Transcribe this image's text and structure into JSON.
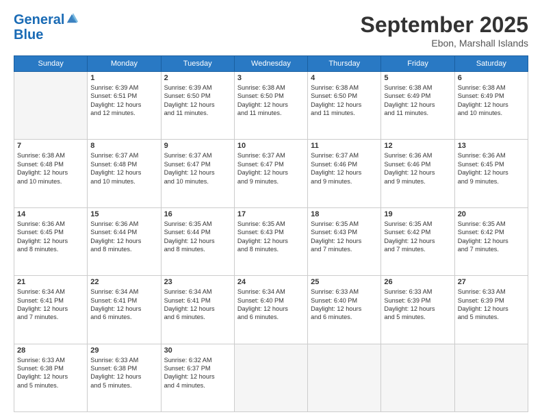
{
  "logo": {
    "line1": "General",
    "line2": "Blue"
  },
  "title": "September 2025",
  "subtitle": "Ebon, Marshall Islands",
  "days_of_week": [
    "Sunday",
    "Monday",
    "Tuesday",
    "Wednesday",
    "Thursday",
    "Friday",
    "Saturday"
  ],
  "weeks": [
    [
      {
        "day": "",
        "text": ""
      },
      {
        "day": "1",
        "text": "Sunrise: 6:39 AM\nSunset: 6:51 PM\nDaylight: 12 hours\nand 12 minutes."
      },
      {
        "day": "2",
        "text": "Sunrise: 6:39 AM\nSunset: 6:50 PM\nDaylight: 12 hours\nand 11 minutes."
      },
      {
        "day": "3",
        "text": "Sunrise: 6:38 AM\nSunset: 6:50 PM\nDaylight: 12 hours\nand 11 minutes."
      },
      {
        "day": "4",
        "text": "Sunrise: 6:38 AM\nSunset: 6:50 PM\nDaylight: 12 hours\nand 11 minutes."
      },
      {
        "day": "5",
        "text": "Sunrise: 6:38 AM\nSunset: 6:49 PM\nDaylight: 12 hours\nand 11 minutes."
      },
      {
        "day": "6",
        "text": "Sunrise: 6:38 AM\nSunset: 6:49 PM\nDaylight: 12 hours\nand 10 minutes."
      }
    ],
    [
      {
        "day": "7",
        "text": "Sunrise: 6:38 AM\nSunset: 6:48 PM\nDaylight: 12 hours\nand 10 minutes."
      },
      {
        "day": "8",
        "text": "Sunrise: 6:37 AM\nSunset: 6:48 PM\nDaylight: 12 hours\nand 10 minutes."
      },
      {
        "day": "9",
        "text": "Sunrise: 6:37 AM\nSunset: 6:47 PM\nDaylight: 12 hours\nand 10 minutes."
      },
      {
        "day": "10",
        "text": "Sunrise: 6:37 AM\nSunset: 6:47 PM\nDaylight: 12 hours\nand 9 minutes."
      },
      {
        "day": "11",
        "text": "Sunrise: 6:37 AM\nSunset: 6:46 PM\nDaylight: 12 hours\nand 9 minutes."
      },
      {
        "day": "12",
        "text": "Sunrise: 6:36 AM\nSunset: 6:46 PM\nDaylight: 12 hours\nand 9 minutes."
      },
      {
        "day": "13",
        "text": "Sunrise: 6:36 AM\nSunset: 6:45 PM\nDaylight: 12 hours\nand 9 minutes."
      }
    ],
    [
      {
        "day": "14",
        "text": "Sunrise: 6:36 AM\nSunset: 6:45 PM\nDaylight: 12 hours\nand 8 minutes."
      },
      {
        "day": "15",
        "text": "Sunrise: 6:36 AM\nSunset: 6:44 PM\nDaylight: 12 hours\nand 8 minutes."
      },
      {
        "day": "16",
        "text": "Sunrise: 6:35 AM\nSunset: 6:44 PM\nDaylight: 12 hours\nand 8 minutes."
      },
      {
        "day": "17",
        "text": "Sunrise: 6:35 AM\nSunset: 6:43 PM\nDaylight: 12 hours\nand 8 minutes."
      },
      {
        "day": "18",
        "text": "Sunrise: 6:35 AM\nSunset: 6:43 PM\nDaylight: 12 hours\nand 7 minutes."
      },
      {
        "day": "19",
        "text": "Sunrise: 6:35 AM\nSunset: 6:42 PM\nDaylight: 12 hours\nand 7 minutes."
      },
      {
        "day": "20",
        "text": "Sunrise: 6:35 AM\nSunset: 6:42 PM\nDaylight: 12 hours\nand 7 minutes."
      }
    ],
    [
      {
        "day": "21",
        "text": "Sunrise: 6:34 AM\nSunset: 6:41 PM\nDaylight: 12 hours\nand 7 minutes."
      },
      {
        "day": "22",
        "text": "Sunrise: 6:34 AM\nSunset: 6:41 PM\nDaylight: 12 hours\nand 6 minutes."
      },
      {
        "day": "23",
        "text": "Sunrise: 6:34 AM\nSunset: 6:41 PM\nDaylight: 12 hours\nand 6 minutes."
      },
      {
        "day": "24",
        "text": "Sunrise: 6:34 AM\nSunset: 6:40 PM\nDaylight: 12 hours\nand 6 minutes."
      },
      {
        "day": "25",
        "text": "Sunrise: 6:33 AM\nSunset: 6:40 PM\nDaylight: 12 hours\nand 6 minutes."
      },
      {
        "day": "26",
        "text": "Sunrise: 6:33 AM\nSunset: 6:39 PM\nDaylight: 12 hours\nand 5 minutes."
      },
      {
        "day": "27",
        "text": "Sunrise: 6:33 AM\nSunset: 6:39 PM\nDaylight: 12 hours\nand 5 minutes."
      }
    ],
    [
      {
        "day": "28",
        "text": "Sunrise: 6:33 AM\nSunset: 6:38 PM\nDaylight: 12 hours\nand 5 minutes."
      },
      {
        "day": "29",
        "text": "Sunrise: 6:33 AM\nSunset: 6:38 PM\nDaylight: 12 hours\nand 5 minutes."
      },
      {
        "day": "30",
        "text": "Sunrise: 6:32 AM\nSunset: 6:37 PM\nDaylight: 12 hours\nand 4 minutes."
      },
      {
        "day": "",
        "text": ""
      },
      {
        "day": "",
        "text": ""
      },
      {
        "day": "",
        "text": ""
      },
      {
        "day": "",
        "text": ""
      }
    ]
  ]
}
